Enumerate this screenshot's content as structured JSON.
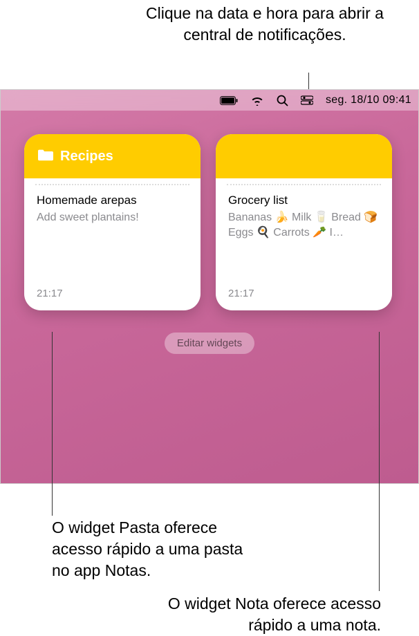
{
  "annotations": {
    "top": "Clique na data e hora para abrir a central de notificações.",
    "left": "O widget Pasta oferece acesso rápido a uma pasta no app Notas.",
    "right": "O widget Nota oferece acesso rápido a uma nota."
  },
  "menubar": {
    "datetime": "seg. 18/10  09:41"
  },
  "widgets": [
    {
      "folder_name": "Recipes",
      "note_title": "Homemade arepas",
      "note_preview": "Add sweet plantains!",
      "time": "21:17"
    },
    {
      "note_title": "Grocery list",
      "note_preview": "Bananas 🍌 Milk 🥛 Bread 🍞 Eggs 🍳 Carrots 🥕 I…",
      "time": "21:17"
    }
  ],
  "edit_button": "Editar widgets"
}
